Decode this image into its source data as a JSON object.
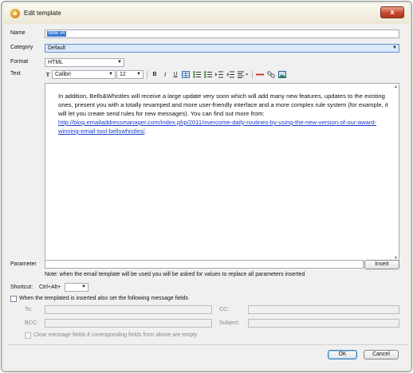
{
  "window": {
    "title": "Edit template",
    "close_glyph": "x"
  },
  "form": {
    "name_label": "Name",
    "name_value": "BBw v4",
    "category_label": "Category",
    "category_value": "Default",
    "format_label": "Format",
    "format_value": "HTML",
    "text_label": "Text"
  },
  "toolbar": {
    "font_icon": "font-icon",
    "font_name": "Calibri",
    "font_size": "12",
    "bold": "B",
    "italic": "I",
    "underline": "U",
    "icons": [
      "bold-icon",
      "italic-icon",
      "underline-icon",
      "table-icon",
      "bullet-list-icon",
      "numbered-list-icon",
      "indent-icon",
      "outdent-icon",
      "align-icon",
      "horizontal-rule-icon",
      "link-icon",
      "image-icon"
    ]
  },
  "editor": {
    "body_text": "In addition, Bells&Whistles will receive a large update very soon which will add many new features, updates to the existing ones, present you with a totally revamped and more user-friendly interface and a more complex rule system (for example, it will let you create send rules for new messages). You can find out more from: ",
    "link_text": "http://blog.emailaddressmanager.com/index.php/2011/overcome-daily-routines-by-using-the-new-version-of-our-award-winning-email-tool-bellswhistles/",
    "trailing_text": "."
  },
  "parameter": {
    "label": "Parameter",
    "value": "",
    "insert_label": "Insert",
    "note": "Note: when the email template will be used you will be asked for values to replace all parameters inserted"
  },
  "shortcut": {
    "label": "Shortcut:",
    "prefix": "Ctrl+Alt+",
    "value": ""
  },
  "message_fields": {
    "checkbox_label": "When the templated is inserted also set the following message fields",
    "to_label": "To:",
    "cc_label": "CC:",
    "bcc_label": "BCC:",
    "subject_label": "Subject:",
    "clear_label": "Clear message fields if corresponding fields from above are empty"
  },
  "buttons": {
    "ok": "OK",
    "cancel": "Cancel"
  },
  "colors": {
    "accent": "#3a78d4",
    "link": "#1a3ec8",
    "close": "#c74a2f"
  }
}
